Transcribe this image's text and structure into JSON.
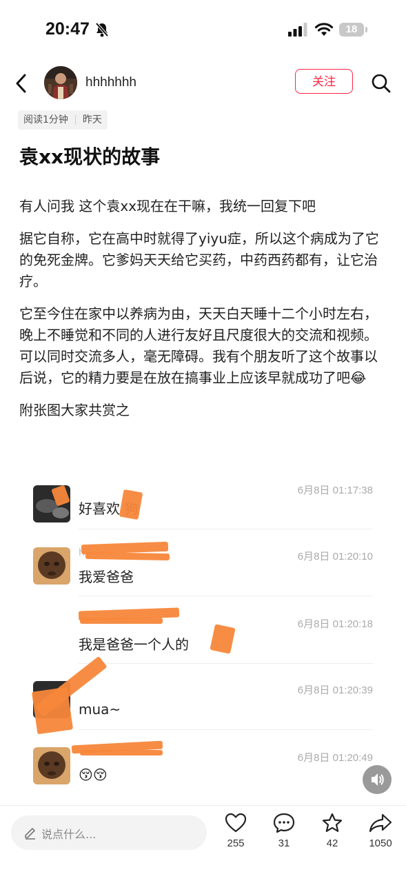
{
  "status": {
    "time": "20:47",
    "battery": "18"
  },
  "header": {
    "username": "hhhhhhh",
    "follow_label": "关注"
  },
  "meta": {
    "read_time": "阅读1分钟",
    "date": "昨天"
  },
  "title": "袁xx现状的故事",
  "paragraphs": [
    "有人问我 这个袁xx现在在干嘛，我统一回复下吧",
    "据它自称，它在高中时就得了yiyu症，所以这个病成为了它的免死金牌。它爹妈天天给它买药，中药西药都有，让它治疗。",
    "它至今住在家中以养病为由，天天白天睡十二个小时左右，晚上不睡觉和不同的人进行友好且尺度很大的交流和视频。可以同时交流多人，毫无障碍。我有个朋友听了这个故事以后说，它的精力要是在放在搞事业上应该早就成功了吧😂",
    "附张图大家共赏之"
  ],
  "chat": {
    "messages": [
      {
        "time": "6月8日 01:17:38",
        "text": "好喜欢 狗"
      },
      {
        "time": "6月8日 01:20:10",
        "text": "我爱爸爸"
      },
      {
        "time": "6月8日 01:20:18",
        "text": "我是爸爸一个人的"
      },
      {
        "time": "6月8日 01:20:39",
        "text": "mua~"
      },
      {
        "time": "6月8日 01:20:49",
        "text": "😚😚"
      }
    ]
  },
  "bottom": {
    "comment_placeholder": "说点什么...",
    "likes": "255",
    "comments": "31",
    "stars": "42",
    "shares": "1050"
  },
  "colors": {
    "accent": "#ff2442",
    "scribble": "#f7873a"
  }
}
